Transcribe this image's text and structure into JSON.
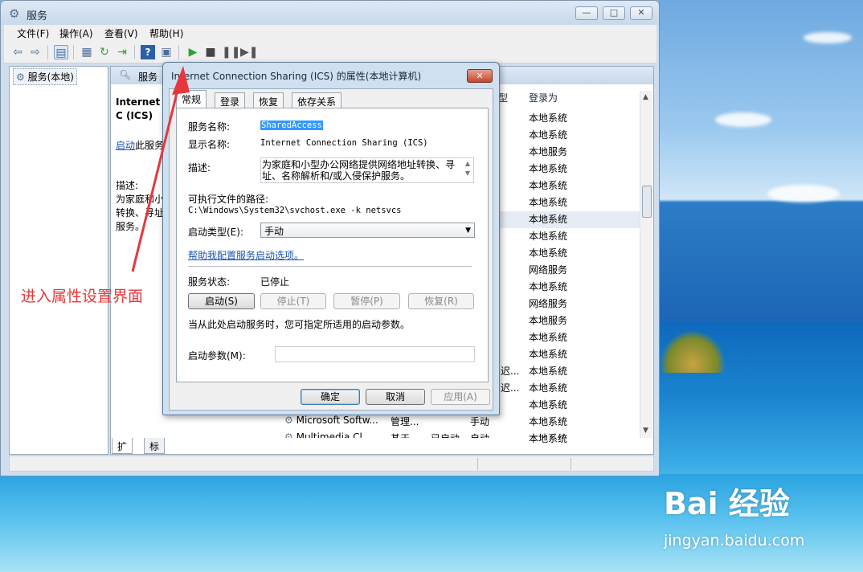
{
  "window": {
    "title": "服务",
    "caption_buttons": [
      "—",
      "□",
      "✕"
    ]
  },
  "menubar": [
    "文件(F)",
    "操作(A)",
    "查看(V)",
    "帮助(H)"
  ],
  "toolbar": {
    "icons": [
      "back-icon",
      "forward-icon",
      "show-hide-tree-icon",
      "properties-icon",
      "refresh-icon",
      "export-icon",
      "help-icon",
      "action-pane-icon",
      "play-icon",
      "stop-icon",
      "pause-icon",
      "resume-icon"
    ]
  },
  "left_pane": {
    "node": "服务(本地)"
  },
  "right_pane": {
    "header": "服务",
    "ext_title": "Internet C (ICS)",
    "start_link": "启动",
    "start_suffix": "此服务",
    "desc_label": "描述:",
    "desc_text": "为家庭和小 转换、寻址 服务。",
    "col_type_fragment": "型",
    "col_logon": "登录为",
    "logon_values": [
      "本地系统",
      "本地系统",
      "本地服务",
      "本地系统",
      "本地系统",
      "本地系统",
      "本地系统",
      "本地系统",
      "本地系统",
      "网络服务",
      "本地系统",
      "网络服务",
      "本地服务",
      "本地系统",
      "本地系统",
      "本地系统",
      "本地系统",
      "本地系统",
      "本地系统",
      "本地系统"
    ],
    "partial_rows": [
      {
        "c2": "迟...",
        "c3": ""
      },
      {
        "c2": "迟...",
        "c3": ""
      }
    ],
    "last_row": {
      "name": "Microsoft Softw...",
      "desc": "管理...",
      "start": "手动",
      "logon": "本地系统"
    },
    "clipped_row": {
      "name": "Multimedia Cl...",
      "desc": "基于...",
      "status": "已启动",
      "start": "自动",
      "logon": "本地系统"
    }
  },
  "bottom_tabs": [
    "扩展",
    "标准"
  ],
  "dialog": {
    "title": "Internet Connection Sharing (ICS) 的属性(本地计算机)",
    "close": "✕",
    "tabs": [
      "常规",
      "登录",
      "恢复",
      "依存关系"
    ],
    "service_name_label": "服务名称:",
    "service_name": "SharedAccess",
    "display_name_label": "显示名称:",
    "display_name": "Internet Connection Sharing (ICS)",
    "description_label": "描述:",
    "description": "为家庭和小型办公网络提供网络地址转换、寻址、名称解析和/或入侵保护服务。",
    "exe_path_label": "可执行文件的路径:",
    "exe_path": "C:\\Windows\\System32\\svchost.exe -k netsvcs",
    "startup_type_label": "启动类型(E):",
    "startup_type": "手动",
    "help_link": "帮助我配置服务启动选项。",
    "status_label": "服务状态:",
    "status": "已停止",
    "btn_start": "启动(S)",
    "btn_stop": "停止(T)",
    "btn_pause": "暂停(P)",
    "btn_resume": "恢复(R)",
    "hint": "当从此处启动服务时，您可指定所适用的启动参数。",
    "param_label": "启动参数(M):",
    "param_value": "",
    "ok": "确定",
    "cancel": "取消",
    "apply": "应用(A)"
  },
  "annotation": "进入属性设置界面",
  "watermark": {
    "brand": "Bai 经验",
    "url": "jingyan.baidu.com"
  },
  "colors": {
    "arrow": "#e8373b",
    "link": "#1a55b5",
    "selection": "#3399ff"
  }
}
